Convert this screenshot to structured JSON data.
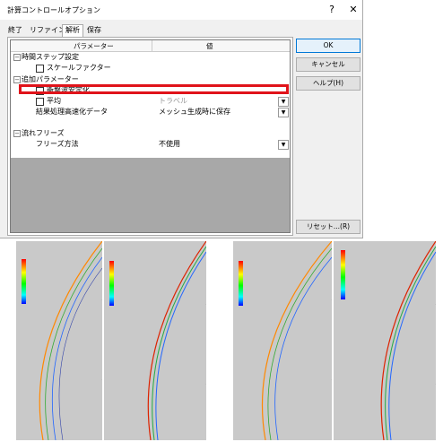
{
  "dialog": {
    "title": "計算コントロールオプション",
    "help_glyph": "?",
    "close_glyph": "✕"
  },
  "tabs": [
    "終了",
    "リファイン",
    "解析",
    "保存"
  ],
  "active_tab": 2,
  "grid": {
    "col_param": "パラメーター",
    "col_value": "値",
    "rows": [
      {
        "label": "時間ステップ設定",
        "value": ""
      },
      {
        "label": "スケールファクター",
        "value": ""
      },
      {
        "label": "追加パラメーター",
        "value": ""
      },
      {
        "label": "衝撃波安定化",
        "value": ""
      },
      {
        "label": "平均",
        "value": "トラベル"
      },
      {
        "label": "結果処理高速化データ",
        "value": "メッシュ生成時に保存"
      },
      {
        "label": "流れフリーズ",
        "value": ""
      },
      {
        "label": "フリーズ方法",
        "value": "不使用"
      }
    ]
  },
  "buttons": {
    "ok": "OK",
    "cancel": "キャンセル",
    "help": "ヘルプ(H)",
    "reset": "リセット...(R)"
  },
  "colors": {
    "highlight": "#e0131a",
    "gray_area": "#a8a8a8",
    "sim_bg": "#c9c9c9"
  },
  "icons": {
    "expand": "minus-box",
    "dropdown": "chevron-down"
  }
}
